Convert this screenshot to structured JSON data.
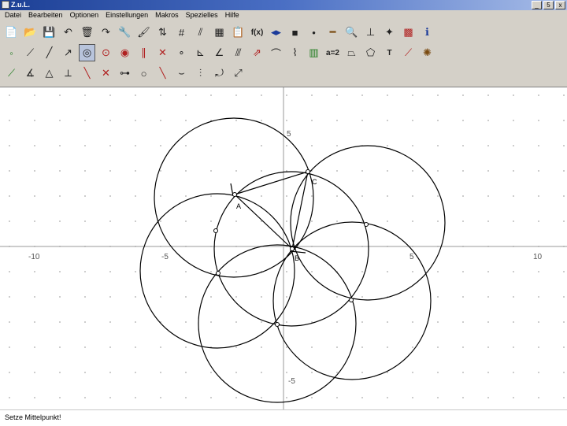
{
  "window": {
    "title": "Z.u.L."
  },
  "window_buttons": {
    "minimize": "_",
    "maximize": "5",
    "close": "x"
  },
  "menu": [
    "Datei",
    "Bearbeiten",
    "Optionen",
    "Einstellungen",
    "Makros",
    "Spezielles",
    "Hilfe"
  ],
  "toolbar_rows": [
    [
      {
        "icon": "new-file-icon",
        "glyph": "📄"
      },
      {
        "icon": "open-folder-icon",
        "glyph": "📂"
      },
      {
        "icon": "save-icon",
        "glyph": "💾"
      },
      {
        "icon": "undo-icon",
        "glyph": "↶"
      },
      {
        "icon": "delete-icon",
        "glyph": "🗑"
      },
      {
        "icon": "redo-icon",
        "glyph": "↷"
      },
      {
        "icon": "wrench-icon",
        "glyph": "🔧"
      },
      {
        "icon": "paint-icon",
        "glyph": "🖌"
      },
      {
        "icon": "sort-icon",
        "glyph": "⇅"
      },
      {
        "icon": "grid-icon",
        "glyph": "#"
      },
      {
        "icon": "hatch-icon",
        "glyph": "⫽"
      },
      {
        "icon": "macro-icon",
        "glyph": "▦"
      },
      {
        "icon": "clipboard-icon",
        "glyph": "📋"
      },
      {
        "icon": "function-icon",
        "glyph": "f(x)",
        "cls": "txt"
      },
      {
        "icon": "arrows-icon",
        "glyph": "◂▸",
        "cls": "blue"
      },
      {
        "icon": "black-square-icon",
        "glyph": "■"
      },
      {
        "icon": "point-icon",
        "glyph": "•"
      },
      {
        "icon": "line-style-icon",
        "glyph": "━",
        "cls": "brown"
      },
      {
        "icon": "zoom-icon",
        "glyph": "🔍"
      },
      {
        "icon": "axes-icon",
        "glyph": "⊥"
      },
      {
        "icon": "magic-wand-icon",
        "glyph": "✦"
      },
      {
        "icon": "colors-icon",
        "glyph": "▩",
        "cls": "red"
      },
      {
        "icon": "info-icon",
        "glyph": "ℹ",
        "cls": "blue"
      }
    ],
    [
      {
        "icon": "point-tool-icon",
        "glyph": "◦",
        "cls": "green"
      },
      {
        "icon": "segment-icon",
        "glyph": "⟋"
      },
      {
        "icon": "line-icon",
        "glyph": "╱"
      },
      {
        "icon": "ray-icon",
        "glyph": "↗"
      },
      {
        "icon": "circle-tool-icon",
        "glyph": "◎",
        "sel": true
      },
      {
        "icon": "circle-three-points-icon",
        "glyph": "⊙",
        "cls": "red"
      },
      {
        "icon": "circle-radius-icon",
        "glyph": "◉",
        "cls": "red"
      },
      {
        "icon": "parallel-icon",
        "glyph": "∥",
        "cls": "red"
      },
      {
        "icon": "intersection-icon",
        "glyph": "✕",
        "cls": "red"
      },
      {
        "icon": "midpoint-icon",
        "glyph": "∘"
      },
      {
        "icon": "perpendicular-icon",
        "glyph": "⊾"
      },
      {
        "icon": "angle-bisector-icon",
        "glyph": "∠"
      },
      {
        "icon": "mirror-icon",
        "glyph": "⫻"
      },
      {
        "icon": "vector-icon",
        "glyph": "⇗",
        "cls": "red"
      },
      {
        "icon": "arc-icon",
        "glyph": "⌒"
      },
      {
        "icon": "polygon-tool-icon",
        "glyph": "⌇"
      },
      {
        "icon": "film-icon",
        "glyph": "▥",
        "cls": "green"
      },
      {
        "icon": "equation-icon",
        "glyph": "a=2",
        "cls": "txt"
      },
      {
        "icon": "quadrilateral-icon",
        "glyph": "⏢"
      },
      {
        "icon": "locus-icon",
        "glyph": "⬠"
      },
      {
        "icon": "text-tool-icon",
        "glyph": "T",
        "cls": "txt"
      },
      {
        "icon": "hide-tool-icon",
        "glyph": "⟋",
        "cls": "red"
      },
      {
        "icon": "animate-icon",
        "glyph": "✺",
        "cls": "brown"
      }
    ],
    [
      {
        "icon": "fixed-segment-icon",
        "glyph": "⟋",
        "cls": "green"
      },
      {
        "icon": "fixed-angle-icon",
        "glyph": "∡"
      },
      {
        "icon": "triangle-icon",
        "glyph": "△"
      },
      {
        "icon": "perpendicular-bisector-icon",
        "glyph": "⟂"
      },
      {
        "icon": "ray-tool-icon",
        "glyph": "╲",
        "cls": "red"
      },
      {
        "icon": "cross-icon",
        "glyph": "✕",
        "cls": "red"
      },
      {
        "icon": "point-on-line-icon",
        "glyph": "⊶"
      },
      {
        "icon": "circle-icon",
        "glyph": "○"
      },
      {
        "icon": "tangent-icon",
        "glyph": "╲",
        "cls": "red"
      },
      {
        "icon": "curve-icon",
        "glyph": "⌣"
      },
      {
        "icon": "reflection-icon",
        "glyph": "⫶"
      },
      {
        "icon": "rotation-icon",
        "glyph": "⤾"
      },
      {
        "icon": "dilation-icon",
        "glyph": "⤢"
      }
    ]
  ],
  "axes": {
    "x_ticks": [
      "-10",
      "-5",
      "5",
      "10"
    ],
    "y_ticks": [
      "5",
      "-5"
    ]
  },
  "point_labels": {
    "a": "A",
    "c": "C",
    "b": "B"
  },
  "status": {
    "text": "Setze Mittelpunkt!"
  }
}
